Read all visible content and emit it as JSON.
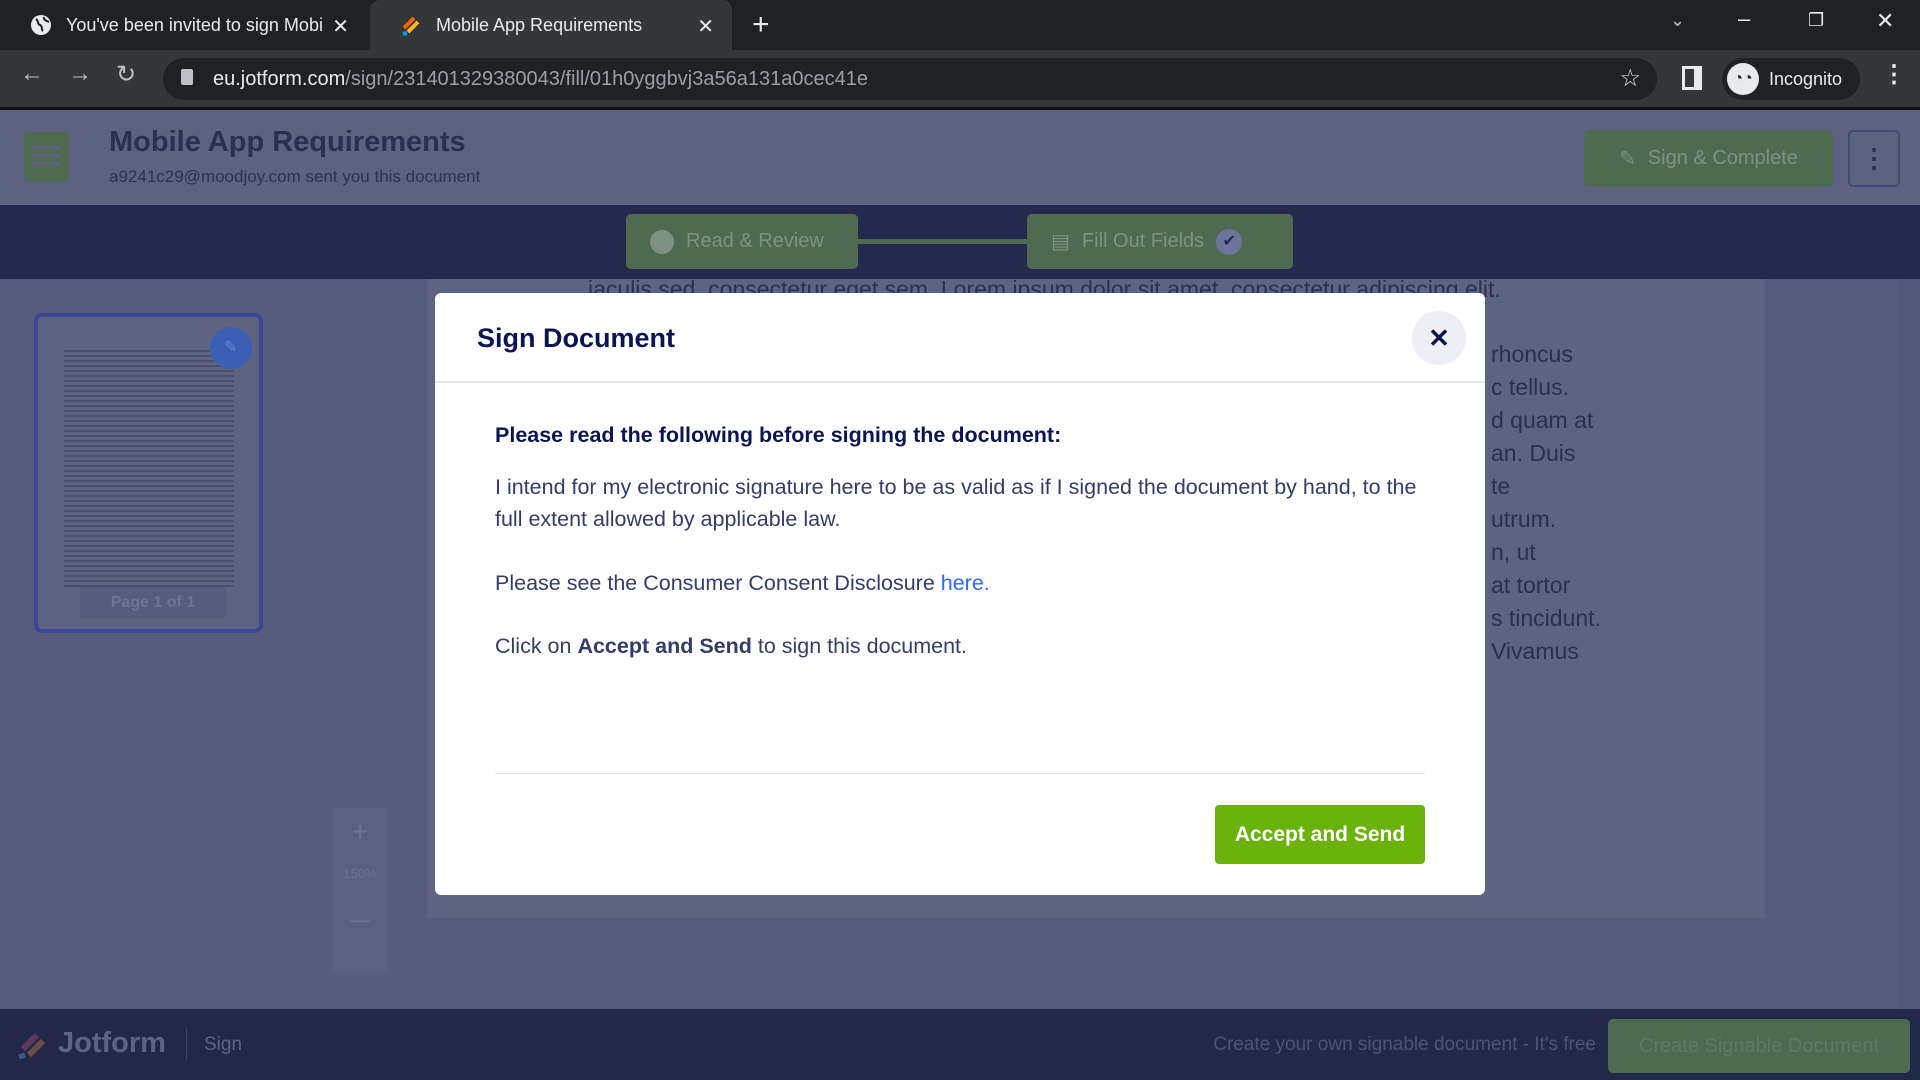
{
  "browser": {
    "tabs": [
      {
        "title": "You've been invited to sign Mobi",
        "icon": "globe-icon"
      },
      {
        "title": "Mobile App Requirements",
        "icon": "jotform-icon",
        "active": true
      }
    ],
    "url_domain": "eu.jotform.com",
    "url_path": "/sign/231401329380043/fill/01h0yggbvj3a56a131a0cec41e",
    "profile": "Incognito"
  },
  "header": {
    "title": "Mobile App Requirements",
    "subtitle": "a9241c29@moodjoy.com sent you this document",
    "sign_complete": "Sign & Complete"
  },
  "steps": [
    {
      "label": "Read & Review",
      "icon": "eye-icon"
    },
    {
      "label": "Fill Out Fields",
      "icon": "fields-icon",
      "done": true
    }
  ],
  "sidebar": {
    "page_label": "Page 1 of 1",
    "zoom": "150%",
    "zoom_in": "+",
    "zoom_out": "—"
  },
  "document": {
    "first_line": "iaculis sed, consectetur eget sem. Lorem ipsum dolor sit amet, consectetur adipiscing elit.",
    "fragments": [
      "rhoncus",
      "c tellus.",
      "d quam at",
      "an. Duis",
      "te",
      "utrum.",
      "n, ut",
      "at tortor",
      "s tincidunt.",
      "Vivamus"
    ]
  },
  "modal": {
    "title": "Sign Document",
    "heading": "Please read the following before signing the document:",
    "paragraph": "I intend for my electronic signature here to be as valid as if I signed the document by hand, to the full extent allowed by applicable law.",
    "consent_prefix": "Please see the Consumer Consent Disclosure ",
    "consent_link": "here.",
    "click_prefix": "Click on ",
    "click_bold": "Accept and Send",
    "click_suffix": " to sign this document.",
    "accept_button": "Accept and Send",
    "accent": "#6bb30c",
    "link_color": "#2e69ff"
  },
  "footer": {
    "brand": "Jotform",
    "product": "Sign",
    "promo": "Create your own signable document - It's free",
    "create_button": "Create Signable Document"
  }
}
